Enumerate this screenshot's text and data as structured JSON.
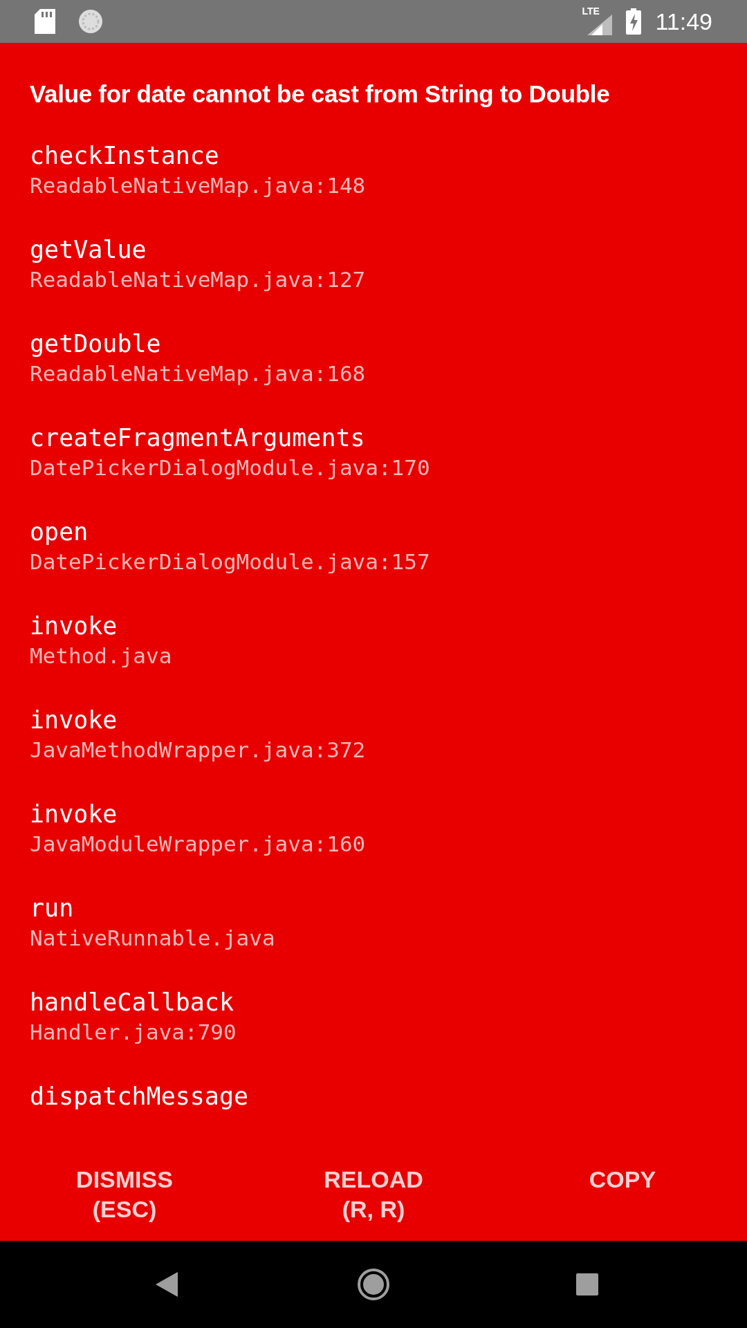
{
  "status_bar": {
    "network": "LTE",
    "time": "11:49"
  },
  "error": {
    "title": "Value for date cannot be cast from String to Double",
    "stack": [
      {
        "method": "checkInstance",
        "file": "ReadableNativeMap.java:148"
      },
      {
        "method": "getValue",
        "file": "ReadableNativeMap.java:127"
      },
      {
        "method": "getDouble",
        "file": "ReadableNativeMap.java:168"
      },
      {
        "method": "createFragmentArguments",
        "file": "DatePickerDialogModule.java:170"
      },
      {
        "method": "open",
        "file": "DatePickerDialogModule.java:157"
      },
      {
        "method": "invoke",
        "file": "Method.java"
      },
      {
        "method": "invoke",
        "file": "JavaMethodWrapper.java:372"
      },
      {
        "method": "invoke",
        "file": "JavaModuleWrapper.java:160"
      },
      {
        "method": "run",
        "file": "NativeRunnable.java"
      },
      {
        "method": "handleCallback",
        "file": "Handler.java:790"
      },
      {
        "method": "dispatchMessage"
      }
    ]
  },
  "buttons": [
    {
      "label": "DISMISS",
      "shortcut": "(ESC)"
    },
    {
      "label": "RELOAD",
      "shortcut": "(R, R)"
    },
    {
      "label": "COPY"
    }
  ]
}
